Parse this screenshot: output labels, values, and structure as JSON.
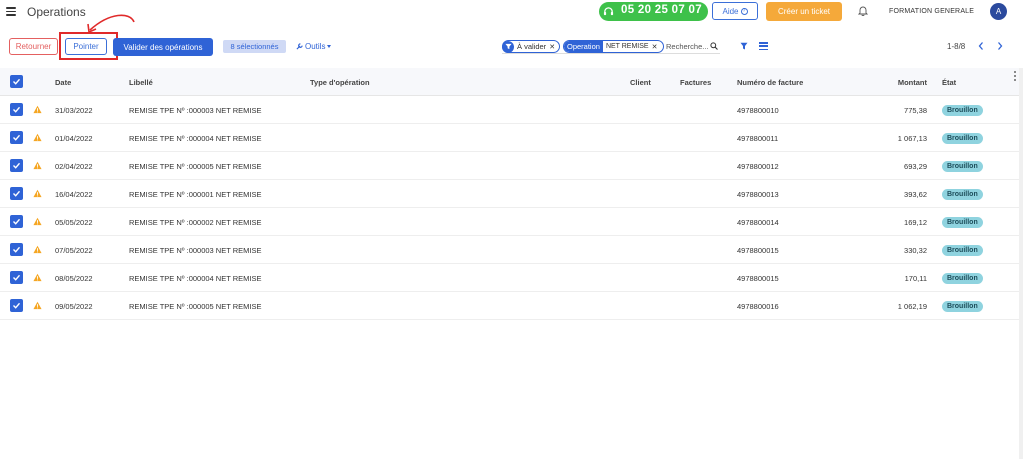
{
  "header": {
    "title": "Operations",
    "phone": "05 20 25 07 07",
    "aide_label": "Aide",
    "ticket_label": "Créer un ticket",
    "company": "FORMATION GENERALE",
    "avatar_initial": "A"
  },
  "toolbar": {
    "retourner_label": "Retourner",
    "pointer_label": "Pointer",
    "valider_label": "Valider des opérations",
    "selected_label": "8 sélectionnés",
    "outils_label": "Outils"
  },
  "filters": {
    "chip_status": "À valider",
    "chip_op_label": "Operation",
    "chip_op_value": "NET REMISE",
    "search_placeholder": "Recherche..."
  },
  "pager": {
    "range": "1-8/8"
  },
  "table": {
    "columns": {
      "date": "Date",
      "libelle": "Libellé",
      "type": "Type d'opération",
      "client": "Client",
      "factures": "Factures",
      "numero": "Numéro de facture",
      "montant": "Montant",
      "etat": "État"
    },
    "rows": [
      {
        "date": "31/03/2022",
        "libelle": "REMISE TPE Nº :000003 NET REMISE",
        "numero": "4978800010",
        "montant": "775,38",
        "etat": "Brouillon"
      },
      {
        "date": "01/04/2022",
        "libelle": "REMISE TPE Nº :000004 NET REMISE",
        "numero": "4978800011",
        "montant": "1 067,13",
        "etat": "Brouillon"
      },
      {
        "date": "02/04/2022",
        "libelle": "REMISE TPE Nº :000005 NET REMISE",
        "numero": "4978800012",
        "montant": "693,29",
        "etat": "Brouillon"
      },
      {
        "date": "16/04/2022",
        "libelle": "REMISE TPE Nº :000001 NET REMISE",
        "numero": "4978800013",
        "montant": "393,62",
        "etat": "Brouillon"
      },
      {
        "date": "05/05/2022",
        "libelle": "REMISE TPE Nº :000002 NET REMISE",
        "numero": "4978800014",
        "montant": "169,12",
        "etat": "Brouillon"
      },
      {
        "date": "07/05/2022",
        "libelle": "REMISE TPE Nº :000003 NET REMISE",
        "numero": "4978800015",
        "montant": "330,32",
        "etat": "Brouillon"
      },
      {
        "date": "08/05/2022",
        "libelle": "REMISE TPE Nº :000004 NET REMISE",
        "numero": "4978800015",
        "montant": "170,11",
        "etat": "Brouillon"
      },
      {
        "date": "09/05/2022",
        "libelle": "REMISE TPE Nº :000005 NET REMISE",
        "numero": "4978800016",
        "montant": "1 062,19",
        "etat": "Brouillon"
      }
    ]
  },
  "colors": {
    "accent": "#2f63d6",
    "phone_green": "#3ec14a",
    "ticket_orange": "#f5a93a",
    "danger": "#e46060",
    "status_badge": "#8fd3df",
    "annotation_red": "#e02a2a"
  },
  "icons": {
    "menu": "hamburger-icon",
    "support": "headset-icon",
    "notifications": "bell-icon",
    "tools": "wrench-icon",
    "filter": "funnel-icon",
    "search": "magnifier-icon",
    "list": "list-icon",
    "row_warning": "warning-icon"
  }
}
